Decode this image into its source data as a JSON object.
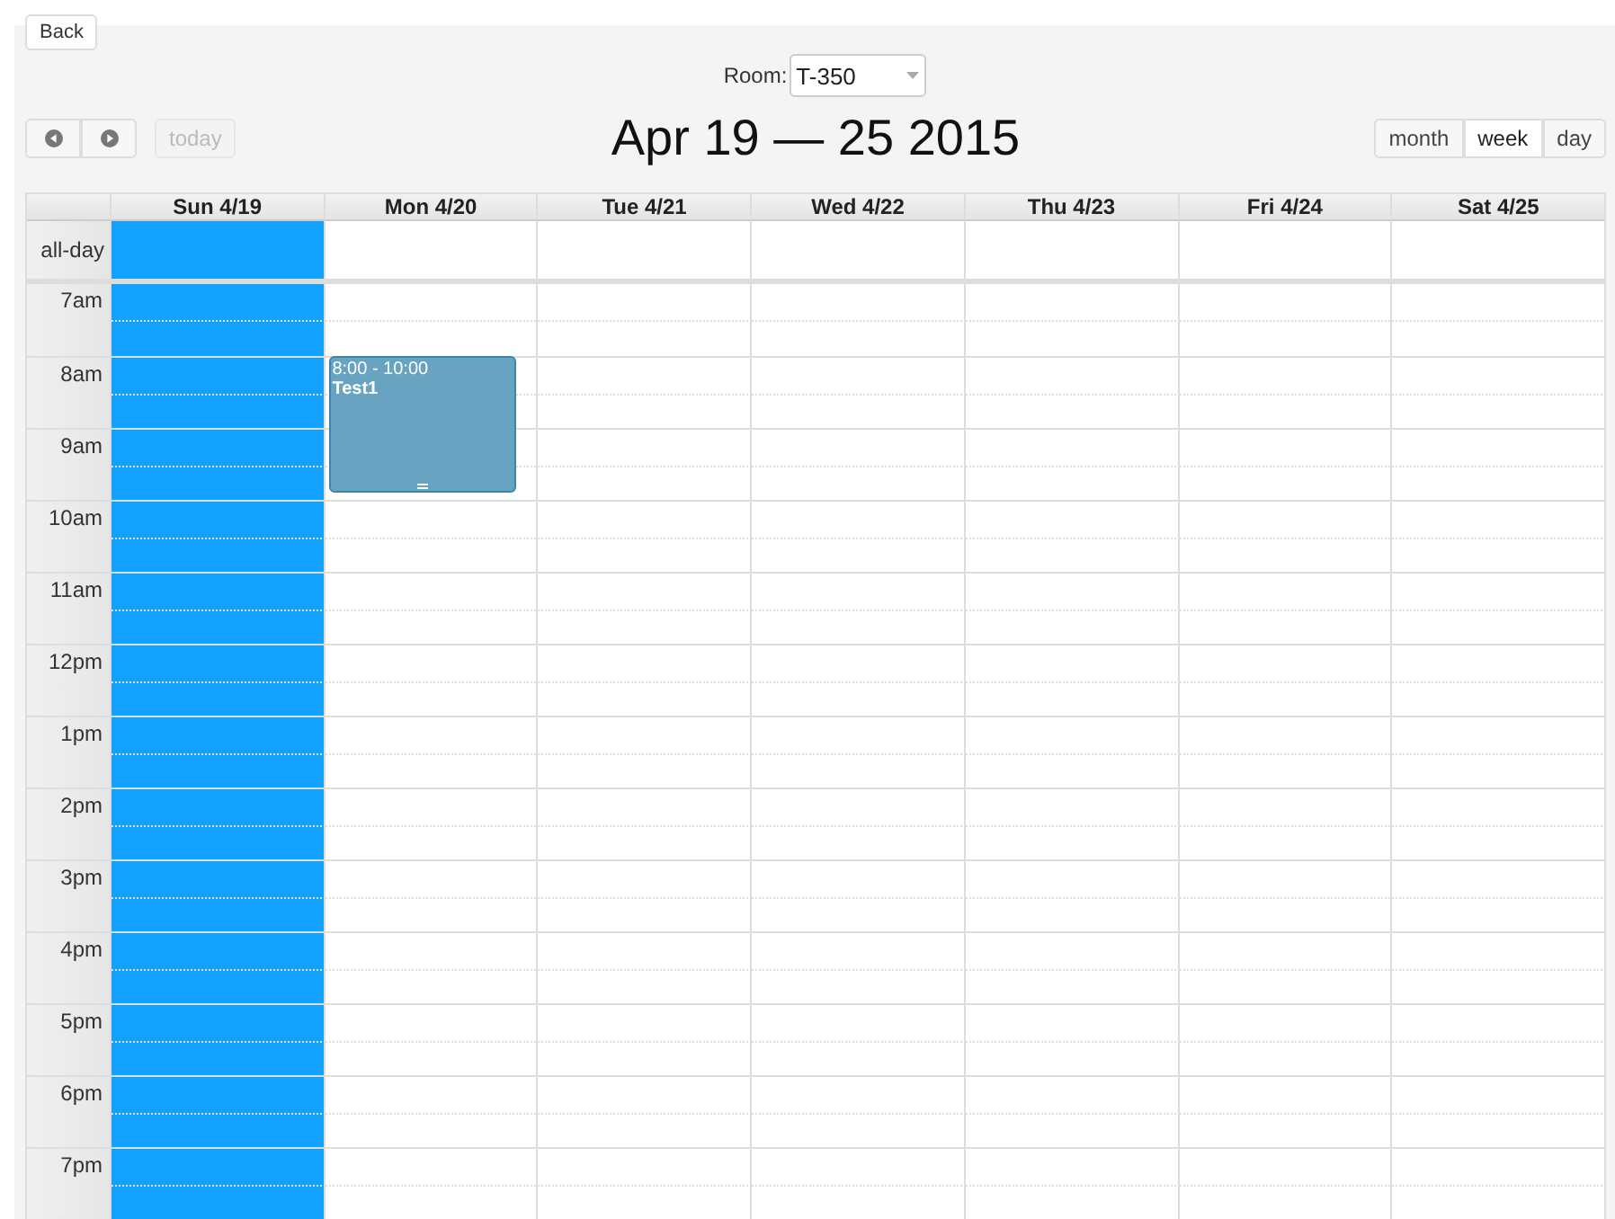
{
  "back_button": "Back",
  "room": {
    "label": "Room:",
    "value": "T-350"
  },
  "toolbar": {
    "today": {
      "label": "today",
      "disabled": true
    },
    "title": "Apr 19 — 25 2015",
    "views": [
      {
        "label": "month",
        "selected": false
      },
      {
        "label": "week",
        "selected": true
      },
      {
        "label": "day",
        "selected": false
      }
    ]
  },
  "all_day_label": "all-day",
  "days": [
    {
      "label": "Sun 4/19",
      "today": true
    },
    {
      "label": "Mon 4/20",
      "today": false,
      "events": [
        {
          "time": "8:00 - 10:00",
          "title": "Test1"
        }
      ]
    },
    {
      "label": "Tue 4/21",
      "today": false
    },
    {
      "label": "Wed 4/22",
      "today": false
    },
    {
      "label": "Thu 4/23",
      "today": false
    },
    {
      "label": "Fri 4/24",
      "today": false
    },
    {
      "label": "Sat 4/25",
      "today": false
    }
  ],
  "hours": [
    "7am",
    "8am",
    "9am",
    "10am",
    "11am",
    "12pm",
    "1pm",
    "2pm",
    "3pm",
    "4pm",
    "5pm",
    "6pm",
    "7pm"
  ]
}
